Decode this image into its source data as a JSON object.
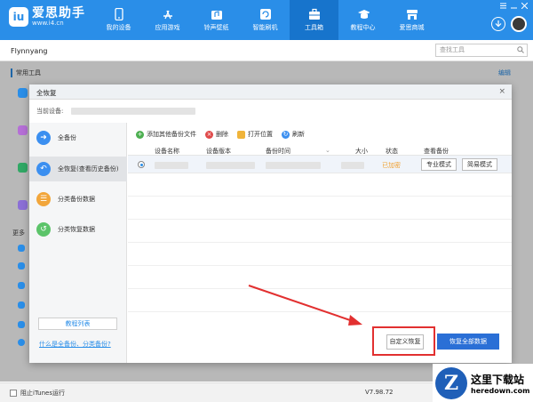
{
  "app": {
    "title": "爱思助手",
    "url": "www.i4.cn",
    "brand_color": "#2a8ee8"
  },
  "nav": {
    "items": [
      {
        "label": "我的设备",
        "icon": "phone-icon",
        "active": false
      },
      {
        "label": "应用游戏",
        "icon": "app-store-icon",
        "active": false
      },
      {
        "label": "铃声壁纸",
        "icon": "ringtone-icon",
        "active": false
      },
      {
        "label": "智能刷机",
        "icon": "flash-icon",
        "active": false
      },
      {
        "label": "工具箱",
        "icon": "toolbox-icon",
        "active": true
      },
      {
        "label": "教程中心",
        "icon": "tutorial-icon",
        "active": false
      },
      {
        "label": "爱思商城",
        "icon": "shop-icon",
        "active": false
      }
    ]
  },
  "tabbar": {
    "device_name": "Flynnyang",
    "search_placeholder": "查找工具"
  },
  "background": {
    "section_title": "常用工具",
    "edit_label": "编辑",
    "more_label": "更多"
  },
  "modal": {
    "title": "全恢复",
    "current_device_label": "当前设备:",
    "menu": [
      {
        "label": "全备份",
        "icon": "backup-arrow-icon",
        "color": "#3b8ff0",
        "active": false
      },
      {
        "label": "全恢复(查看历史备份)",
        "icon": "restore-arrow-icon",
        "color": "#3b8ff0",
        "active": true
      },
      {
        "label": "分类备份数据",
        "icon": "category-backup-icon",
        "color": "#f2a63b",
        "active": false
      },
      {
        "label": "分类恢复数据",
        "icon": "category-restore-icon",
        "color": "#5cc46a",
        "active": false
      }
    ],
    "tutorial_button": "教程列表",
    "help_link": "什么是全备份、分类备份?",
    "toolbar": [
      {
        "label": "添加其他备份文件",
        "icon": "add-icon",
        "color": "#4caf50"
      },
      {
        "label": "删除",
        "icon": "delete-icon",
        "color": "#e04a4a"
      },
      {
        "label": "打开位置",
        "icon": "folder-icon",
        "color": "#f0b43a"
      },
      {
        "label": "刷新",
        "icon": "refresh-icon",
        "color": "#3b8ff0"
      }
    ],
    "columns": [
      "设备名称",
      "设备版本",
      "备份时间",
      "大小",
      "状态",
      "查看备份"
    ],
    "rows": [
      {
        "status": "已加密",
        "pro_mode": "专业模式",
        "simple_mode": "简易模式"
      }
    ],
    "custom_restore_button": "自定义恢复",
    "restore_all_button": "恢复全部数据"
  },
  "statusbar": {
    "itunes_label": "阻止iTunes运行",
    "version": "V7.98.72"
  },
  "watermark": {
    "logo_letter": "Z",
    "title": "这里下载站",
    "url": "heredown.com"
  }
}
